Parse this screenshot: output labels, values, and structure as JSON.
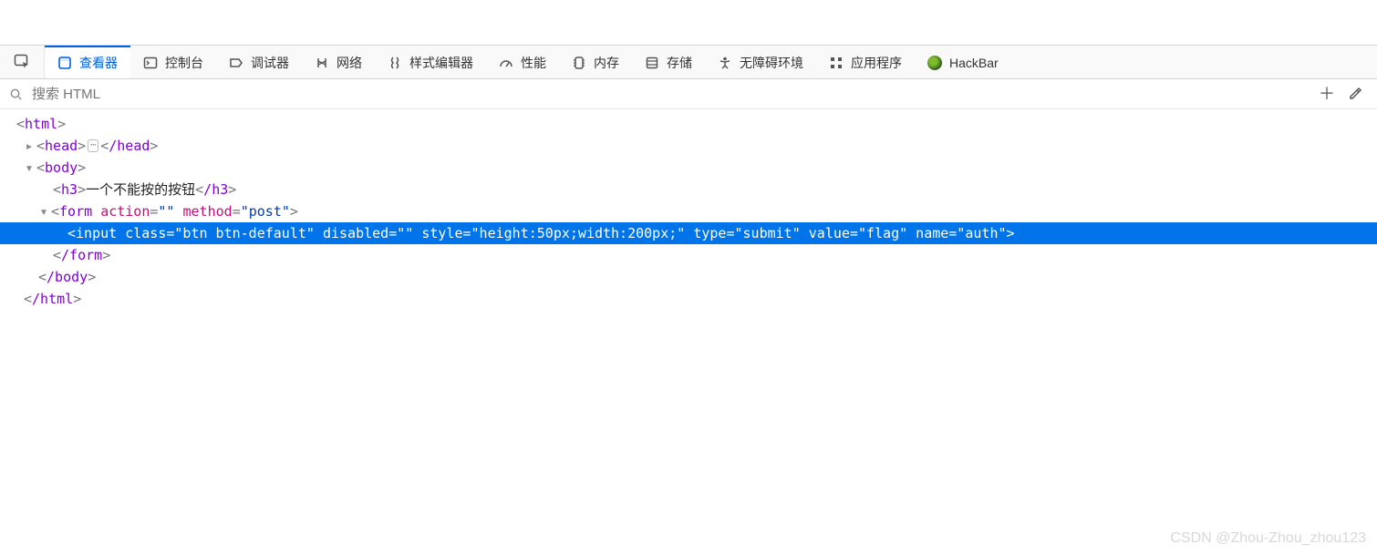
{
  "search": {
    "placeholder": "搜索 HTML"
  },
  "tabs": [
    {
      "label": "查看器",
      "active": true
    },
    {
      "label": "控制台",
      "active": false
    },
    {
      "label": "调试器",
      "active": false
    },
    {
      "label": "网络",
      "active": false
    },
    {
      "label": "样式编辑器",
      "active": false
    },
    {
      "label": "性能",
      "active": false
    },
    {
      "label": "内存",
      "active": false
    },
    {
      "label": "存储",
      "active": false
    },
    {
      "label": "无障碍环境",
      "active": false
    },
    {
      "label": "应用程序",
      "active": false
    },
    {
      "label": "HackBar",
      "active": false
    }
  ],
  "dom": {
    "html_open": "html",
    "head_open": "head",
    "head_close": "/head",
    "body_open": "body",
    "h3_open": "h3",
    "h3_text": "一个不能按的按钮",
    "h3_close": "/h3",
    "form_tag": "form",
    "form_attr_action_name": "action",
    "form_attr_action_val": "\"\"",
    "form_attr_method_name": "method",
    "form_attr_method_val": "\"post\"",
    "input_line": "<input class=\"btn btn-default\" disabled=\"\" style=\"height:50px;width:200px;\" type=\"submit\" value=\"flag\" name=\"auth\">",
    "form_close": "/form",
    "body_close": "/body",
    "html_close": "/html"
  },
  "watermark": "CSDN @Zhou-Zhou_zhou123"
}
